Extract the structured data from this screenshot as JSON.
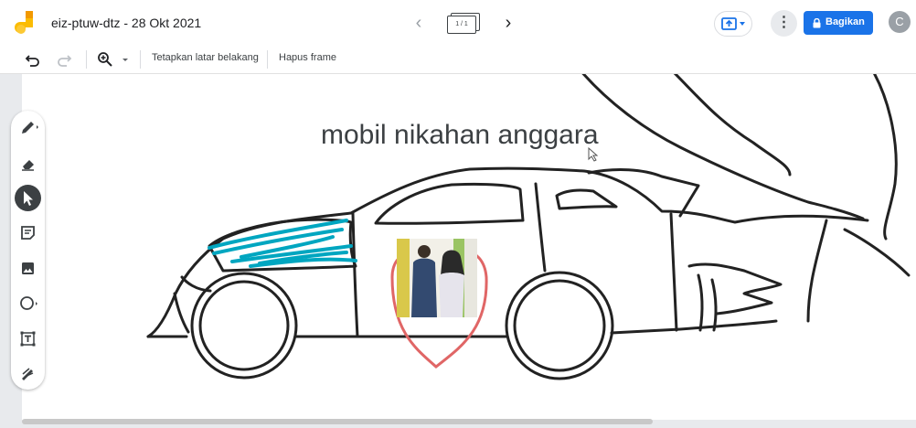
{
  "header": {
    "doc_title": "eiz-ptuw-dtz - 28 Okt 2021",
    "frame_counter": "1 / 1",
    "share_label": "Bagikan",
    "avatar_initial": "C"
  },
  "toolbar": {
    "set_background_label": "Tetapkan latar belakang",
    "delete_frame_label": "Hapus frame"
  },
  "canvas": {
    "title": "mobil nikahan anggara"
  },
  "tools": [
    "pen",
    "eraser",
    "select",
    "sticky-note",
    "image",
    "shape",
    "text-box",
    "laser"
  ],
  "colors": {
    "accent": "#1a73e8",
    "scribble": "#00a6c0",
    "heart": "#e06666",
    "stroke": "#222222"
  }
}
